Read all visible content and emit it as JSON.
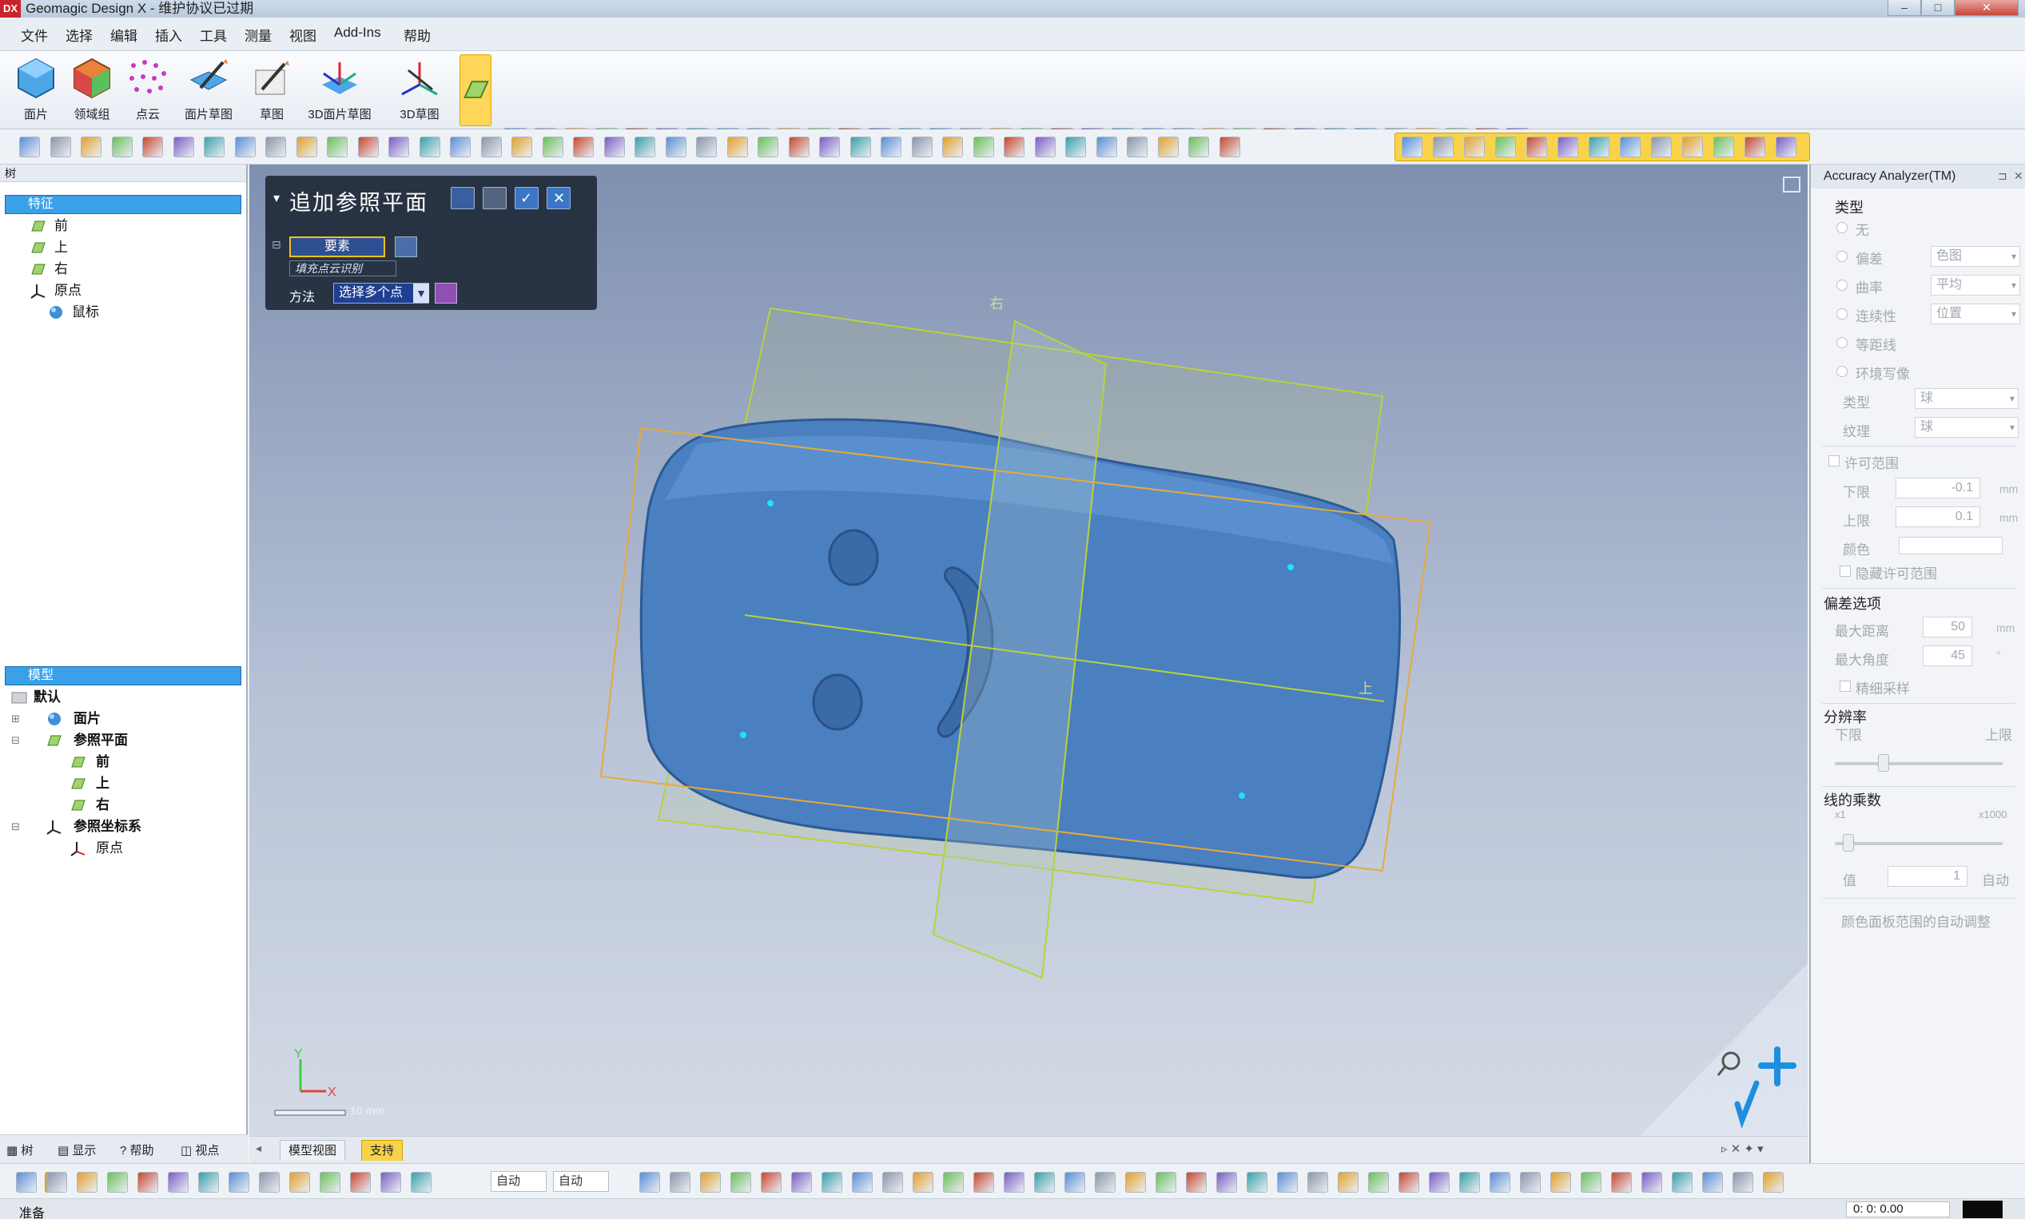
{
  "window": {
    "logo": "DX",
    "title": "Geomagic Design X - 维护协议已过期",
    "controls": [
      "–",
      "□",
      "✕"
    ]
  },
  "menu": [
    "文件",
    "选择",
    "编辑",
    "插入",
    "工具",
    "测量",
    "视图",
    "Add-Ins",
    "帮助"
  ],
  "ribbon": {
    "big_tools": [
      {
        "label": "面片",
        "icon": "mesh-icon"
      },
      {
        "label": "领域组",
        "icon": "region-group-icon"
      },
      {
        "label": "点云",
        "icon": "point-cloud-icon"
      },
      {
        "label": "面片草图",
        "icon": "mesh-sketch-icon"
      },
      {
        "label": "草图",
        "icon": "sketch-icon"
      },
      {
        "label": "3D面片草图",
        "icon": "3d-mesh-sketch-icon"
      },
      {
        "label": "3D草图",
        "icon": "3d-sketch-icon"
      }
    ]
  },
  "left_panel": {
    "header": "树",
    "features_section": "特征",
    "feature_items": [
      {
        "label": "前",
        "icon": "plane-icon"
      },
      {
        "label": "上",
        "icon": "plane-icon"
      },
      {
        "label": "右",
        "icon": "plane-icon"
      },
      {
        "label": "原点",
        "icon": "origin-icon"
      },
      {
        "label": "鼠标",
        "icon": "mesh-sphere-icon"
      }
    ],
    "model_section": "模型",
    "model_items": [
      {
        "label": "默认",
        "icon": "folder-icon",
        "bold": true
      },
      {
        "label": "面片",
        "icon": "mesh-sphere-icon",
        "bold": true
      },
      {
        "label": "参照平面",
        "icon": "plane-icon",
        "bold": true
      },
      {
        "label": "前",
        "icon": "plane-icon",
        "bold": true
      },
      {
        "label": "上",
        "icon": "plane-icon",
        "bold": true
      },
      {
        "label": "右",
        "icon": "plane-icon",
        "bold": true
      },
      {
        "label": "参照坐标系",
        "icon": "origin-icon",
        "bold": true
      },
      {
        "label": "原点",
        "icon": "origin-icon",
        "bold": false
      }
    ],
    "tabs": [
      "树",
      "显示",
      "帮助",
      "视点"
    ]
  },
  "viewport": {
    "dialog_title": "追加参照平面",
    "element_field": "要素",
    "element_hint": "填充点云识别",
    "method_label": "方法",
    "method_value": "选择多个点",
    "plane_label_right": "右",
    "plane_label_top": "上",
    "scale_label": "10 mm",
    "axis_x": "X",
    "axis_y": "Y",
    "tabs": [
      "模型视图",
      "支持"
    ],
    "active_tab": "支持"
  },
  "right_panel": {
    "title": "Accuracy Analyzer(TM)",
    "type_group": "类型",
    "type_options": [
      {
        "label": "无",
        "select": ""
      },
      {
        "label": "偏差",
        "select": "色图"
      },
      {
        "label": "曲率",
        "select": "平均"
      },
      {
        "label": "连续性",
        "select": "位置"
      },
      {
        "label": "等距线",
        "select": ""
      },
      {
        "label": "环境写像",
        "select": ""
      }
    ],
    "sub_type_label": "类型",
    "sub_type_value": "球",
    "texture_label": "纹理",
    "texture_value": "球",
    "tolerance_label": "许可范围",
    "lower_label": "下限",
    "lower_value": "-0.1",
    "upper_label": "上限",
    "upper_value": "0.1",
    "unit": "mm",
    "color_label": "颜色",
    "hide_tolerance": "隐藏许可范围",
    "deviation_group": "偏差选项",
    "max_distance_label": "最大距离",
    "max_distance_value": "50",
    "max_angle_label": "最大角度",
    "max_angle_value": "45",
    "degree_unit": "°",
    "fine_sampling": "精细采样",
    "resolution_group": "分辨率",
    "resolution_low": "下限",
    "resolution_high": "上限",
    "line_multiplier_group": "线的乘数",
    "multiplier_min": "x1",
    "multiplier_max": "x1000",
    "value_label": "值",
    "value": "1",
    "auto_label": "自动",
    "auto_adjust": "颜色面板范围的自动调整"
  },
  "bottom": {
    "combo1": "自动",
    "combo2": "自动",
    "status": "准备",
    "time": "0: 0: 0.00"
  },
  "colors": {
    "accent_yellow": "#f8d34a",
    "selection_blue": "#3aa0e8",
    "mesh_blue": "#4a7fc0",
    "plane_green": "#b9d23a",
    "plane_orange": "#e7a93c"
  }
}
